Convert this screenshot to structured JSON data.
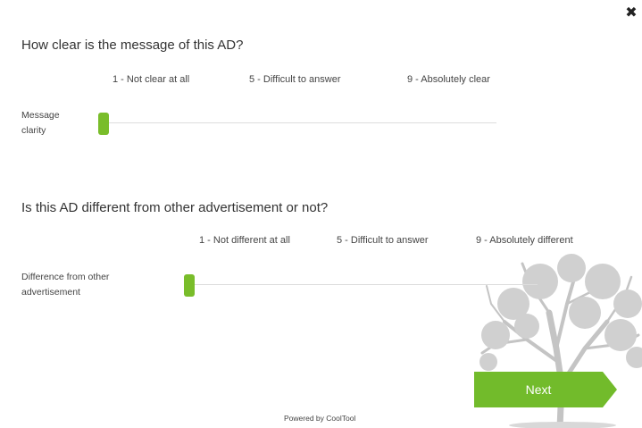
{
  "survey": {
    "close_icon": "close-icon",
    "questions": [
      {
        "title": "How clear is the message of this AD?",
        "row_label": "Message clarity",
        "anchors": [
          "1 - Not clear at all",
          "5 - Difficult to answer",
          "9 - Absolutely clear"
        ],
        "scale_min": 1,
        "scale_max": 9,
        "value": 1
      },
      {
        "title": "Is this AD different from other advertisement or not?",
        "row_label": "Difference from other advertisement",
        "anchors": [
          "1 - Not different at all",
          "5 - Difficult to answer",
          "9 - Absolutely different"
        ],
        "scale_min": 1,
        "scale_max": 9,
        "value": 1
      }
    ],
    "next_label": "Next",
    "powered_by": "Powered by CoolTool"
  },
  "colors": {
    "accent": "#79bd2a",
    "next_button": "#72bb2b",
    "track": "#dddddd",
    "tree": "#c8c8c8"
  }
}
